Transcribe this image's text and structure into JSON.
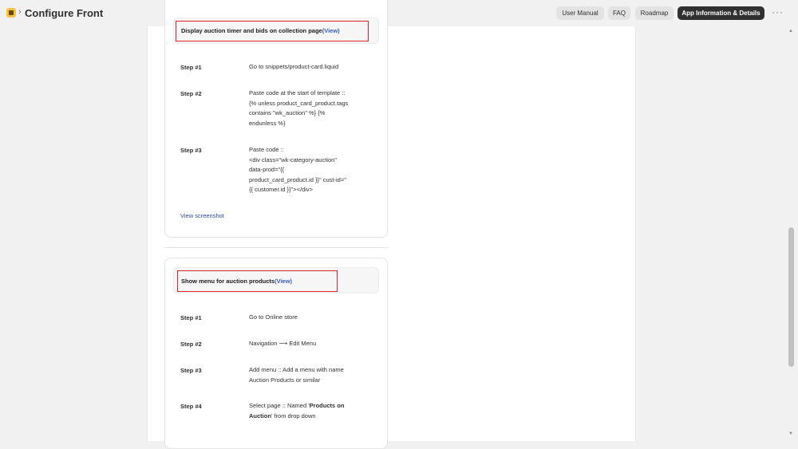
{
  "header": {
    "title": "Configure Front",
    "buttons": {
      "user_manual": "User Manual",
      "faq": "FAQ",
      "roadmap": "Roadmap",
      "app_info": "App Information & Details"
    },
    "more": "···"
  },
  "section1": {
    "heading": "Display auction timer and bids on collection page",
    "view": "(View)",
    "steps": [
      {
        "label": "Step #1",
        "text": "Go to snippets/product-card.liquid"
      },
      {
        "label": "Step #2",
        "text_lines": [
          "Paste code at the start of template ::",
          "{% unless product_card_product.tags",
          "contains \"wk_auction\" %} {%",
          "endunless %}"
        ]
      },
      {
        "label": "Step #3",
        "text_lines": [
          "Paste code ::",
          "<div class=\"wk-category-auction\"",
          "data-prod=\"{{",
          "product_card_product.id }}\" cust-id=\"",
          "{{ customer.id }}\"></div>"
        ]
      }
    ],
    "link": "View screenshot"
  },
  "section2": {
    "heading": "Show menu for auction products",
    "view": "(View)",
    "steps": [
      {
        "label": "Step #1",
        "text": "Go to Online store"
      },
      {
        "label": "Step #2",
        "text": "Navigation ⟶ Edit Menu"
      },
      {
        "label": "Step #3",
        "text_lines": [
          "Add menu :: Add a menu with name",
          "Auction Products or similar"
        ]
      },
      {
        "label": "Step #4",
        "prefix": "Select page :: Named '",
        "bold1": "Products on",
        "bold2": "Auction",
        "suffix": "' from drop down"
      }
    ]
  },
  "colors": {
    "accent_red": "#e0222c",
    "link_blue": "#3a5bbf",
    "dark_button": "#303030"
  }
}
